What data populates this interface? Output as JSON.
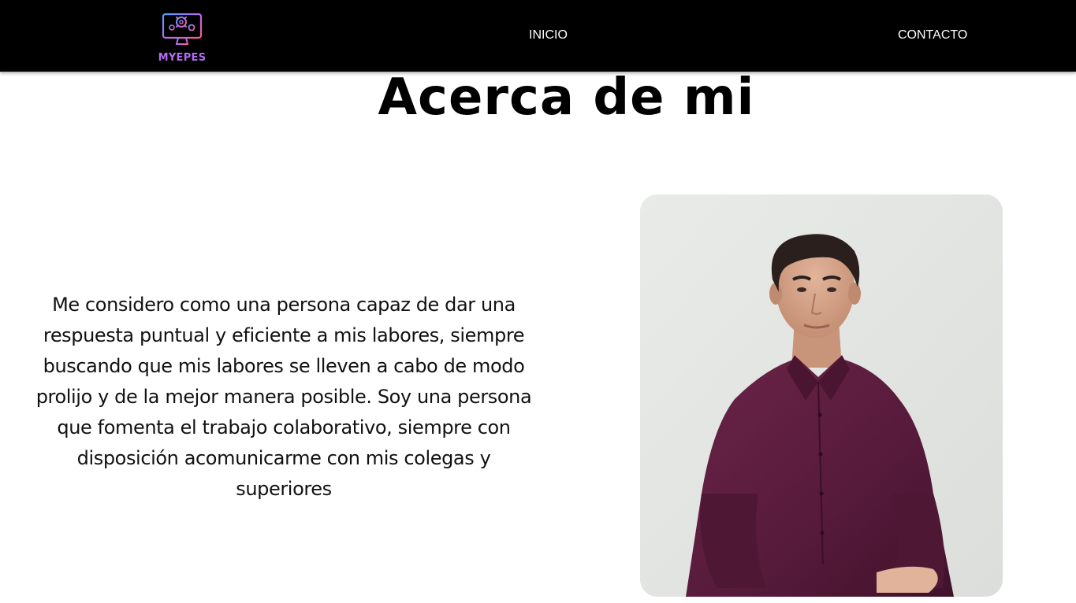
{
  "header": {
    "logo_text": "MYEPES",
    "nav": [
      {
        "label": "INICIO"
      },
      {
        "label": "CONTACTO"
      }
    ]
  },
  "main": {
    "title": "Acerca de mi",
    "paragraph": "Me considero como una persona capaz de dar una respuesta puntual y eficiente a mis labores, siempre buscando que mis labores se lleven a cabo de modo prolijo y de la mejor manera posible. Soy una persona que fomenta el trabajo colaborativo, siempre con disposición acomunicarme con mis colegas y superiores"
  },
  "icons": {
    "logo": "computer-gears-icon"
  },
  "colors": {
    "navbar_bg": "#000000",
    "logo_text": "#b46cf2",
    "shirt": "#5a1d3d",
    "photo_bg": "#e7e8e5"
  }
}
